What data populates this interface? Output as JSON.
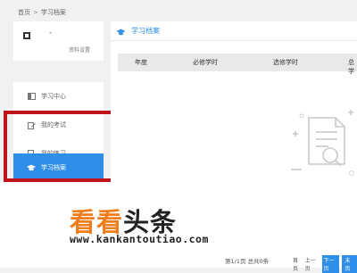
{
  "breadcrumb": {
    "home": "首页",
    "separator": ">",
    "current": "学习档案"
  },
  "profile": {
    "name_placeholder": "-",
    "settings_label": "资料设置"
  },
  "sidebar": {
    "items": [
      {
        "label": "学习中心",
        "icon": "layout-icon",
        "active": false
      },
      {
        "label": "我的考试",
        "icon": "edit-icon",
        "active": false
      },
      {
        "label": "我的练习",
        "icon": "chat-icon",
        "active": false
      },
      {
        "label": "学习档案",
        "icon": "graduation-cap-icon",
        "active": true
      }
    ],
    "active_color": "#2f8ee7"
  },
  "main": {
    "title": "学习档案",
    "table_headers": [
      "年度",
      "必修学时",
      "选修学时",
      "总学"
    ]
  },
  "watermark": {
    "title_orange": "看看",
    "title_black": "头条",
    "url": "www.kankantoutiao.com",
    "orange_color": "#f07d1c"
  },
  "pagination": {
    "info": "第1/1页 总共0条",
    "first": "首页",
    "prev": "上一页",
    "next": "下一页",
    "last": "末页"
  },
  "highlight_color": "#c0131b"
}
